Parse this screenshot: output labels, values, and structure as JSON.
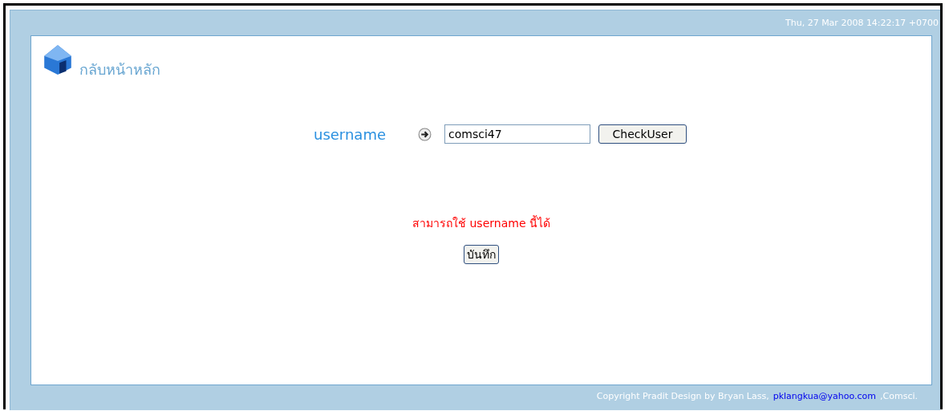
{
  "header": {
    "datetime": "Thu, 27 Mar 2008 14:22:17 +0700"
  },
  "home_link": {
    "label": "กลับหน้าหลัก"
  },
  "form": {
    "label": "username",
    "value": "comsci47",
    "check_button": "CheckUser"
  },
  "message": "สามารถใช้ username นี้ได้",
  "save_button": "บันทึก",
  "footer": {
    "text": "Copyright Pradit Design by Bryan Lass,",
    "email": "pklangkua@yahoo.com",
    "suffix": ",Comsci."
  }
}
